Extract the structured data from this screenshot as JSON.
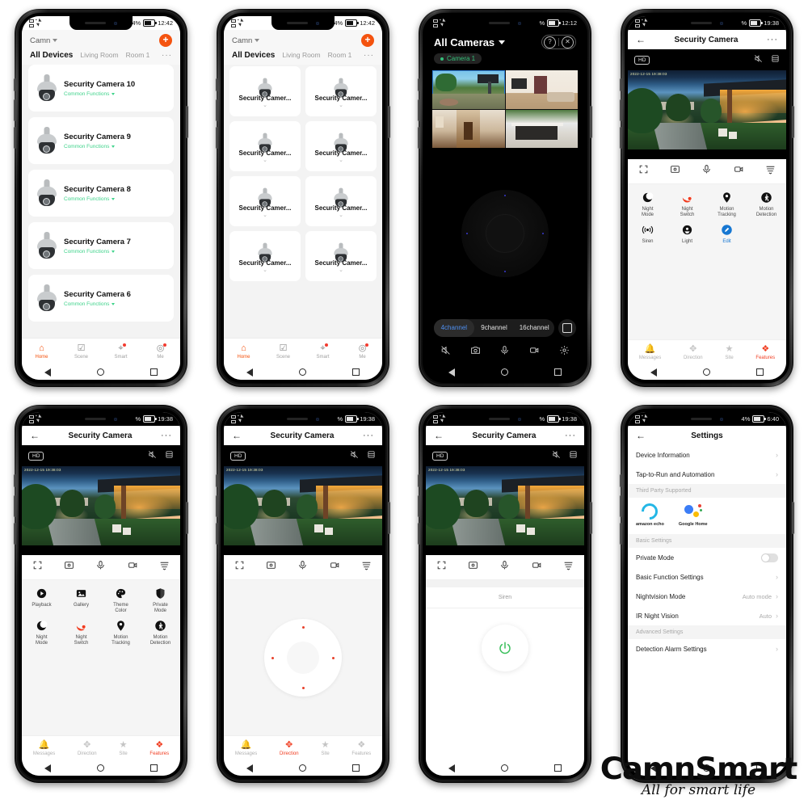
{
  "watermark": {
    "brand": "CamnSmart",
    "tagline": "All for smart life"
  },
  "colors": {
    "accent_orange": "#f4530f",
    "accent_red": "#f03c20",
    "green": "#3fd38b",
    "blue": "#1677d2",
    "select_blue": "#2f7fd6"
  },
  "phone1": {
    "status": {
      "time": "12:42",
      "battery": "4%"
    },
    "family": "Camn",
    "add_label": "+",
    "tabs": [
      {
        "label": "All Devices",
        "active": true
      },
      {
        "label": "Living Room",
        "active": false
      },
      {
        "label": "Room 1",
        "active": false
      }
    ],
    "tabs_more": "···",
    "devices": [
      {
        "name": "Security Camera 10",
        "sub": "Common Functions"
      },
      {
        "name": "Security Camera 9",
        "sub": "Common Functions"
      },
      {
        "name": "Security Camera 8",
        "sub": "Common Functions"
      },
      {
        "name": "Security Camera 7",
        "sub": "Common Functions"
      },
      {
        "name": "Security Camera 6",
        "sub": "Common Functions"
      }
    ],
    "bottom_nav": [
      {
        "label": "Home",
        "active": true
      },
      {
        "label": "Scene",
        "active": false
      },
      {
        "label": "Smart",
        "active": false
      },
      {
        "label": "Me",
        "active": false
      }
    ]
  },
  "phone2": {
    "status": {
      "time": "12:42",
      "battery": "4%"
    },
    "family": "Camn",
    "tabs": [
      {
        "label": "All Devices",
        "active": true
      },
      {
        "label": "Living Room",
        "active": false
      },
      {
        "label": "Room 1",
        "active": false
      }
    ],
    "tabs_more": "···",
    "devices": [
      {
        "name": "Security Camer..."
      },
      {
        "name": "Security Camer..."
      },
      {
        "name": "Security Camer..."
      },
      {
        "name": "Security Camer..."
      },
      {
        "name": "Security Camer..."
      },
      {
        "name": "Security Camer..."
      },
      {
        "name": "Security Camer..."
      },
      {
        "name": "Security Camer..."
      }
    ],
    "bottom_nav": [
      {
        "label": "Home",
        "active": true
      },
      {
        "label": "Scene",
        "active": false
      },
      {
        "label": "Smart",
        "active": false
      },
      {
        "label": "Me",
        "active": false
      }
    ]
  },
  "phone3": {
    "status": {
      "time": "12:12",
      "battery": "%"
    },
    "title": "All Cameras",
    "camera_chip": "Camera 1",
    "help_icon": "?",
    "close_icon": "✕",
    "channels": [
      {
        "label": "4channel",
        "active": true
      },
      {
        "label": "9channel",
        "active": false
      },
      {
        "label": "16channel",
        "active": false
      }
    ],
    "grid_count": 4,
    "toolbar_icons": [
      "mute-icon",
      "snapshot-icon",
      "microphone-icon",
      "record-icon",
      "settings-icon"
    ]
  },
  "phone4": {
    "status": {
      "time": "19:38",
      "battery": "%"
    },
    "title": "Security Camera",
    "quality_badge": "HD",
    "timestamp_overlay": "2022-12-15 19:38:03",
    "controls": [
      "fullscreen-icon",
      "snapshot-icon",
      "microphone-icon",
      "record-icon",
      "playlist-icon"
    ],
    "features": [
      {
        "label": "Night\nMode",
        "icon": "moon-icon",
        "state": "normal"
      },
      {
        "label": "Night\nSwitch",
        "icon": "night-switch-icon",
        "state": "red"
      },
      {
        "label": "Motion\nTracking",
        "icon": "pin-icon",
        "state": "normal"
      },
      {
        "label": "Motion\nDetection",
        "icon": "walking-icon",
        "state": "normal"
      },
      {
        "label": "Siren",
        "icon": "siren-icon",
        "state": "normal"
      },
      {
        "label": "Light",
        "icon": "light-icon",
        "state": "normal"
      },
      {
        "label": "Edit",
        "icon": "edit-icon",
        "state": "blue"
      }
    ],
    "bottom_nav": [
      {
        "label": "Messages",
        "active": false
      },
      {
        "label": "Direction",
        "active": false
      },
      {
        "label": "Site",
        "active": false
      },
      {
        "label": "Features",
        "active": true
      }
    ]
  },
  "phone5": {
    "status": {
      "time": "19:38",
      "battery": "%"
    },
    "title": "Security Camera",
    "quality_badge": "HD",
    "timestamp_overlay": "2022-12-15 19:38:03",
    "features": [
      {
        "label": "Playback",
        "icon": "play-icon",
        "state": "normal"
      },
      {
        "label": "Gallery",
        "icon": "image-icon",
        "state": "normal"
      },
      {
        "label": "Theme\nColor",
        "icon": "palette-icon",
        "state": "normal"
      },
      {
        "label": "Private\nMode",
        "icon": "shield-icon",
        "state": "normal"
      },
      {
        "label": "Night\nMode",
        "icon": "moon-icon",
        "state": "normal"
      },
      {
        "label": "Night\nSwitch",
        "icon": "night-switch-icon",
        "state": "red"
      },
      {
        "label": "Motion\nTracking",
        "icon": "pin-icon",
        "state": "normal"
      },
      {
        "label": "Motion\nDetection",
        "icon": "walking-icon",
        "state": "normal"
      }
    ],
    "bottom_nav": [
      {
        "label": "Messages",
        "active": false
      },
      {
        "label": "Direction",
        "active": false
      },
      {
        "label": "Site",
        "active": false
      },
      {
        "label": "Features",
        "active": true
      }
    ]
  },
  "phone6": {
    "status": {
      "time": "19:38",
      "battery": "%"
    },
    "title": "Security Camera",
    "quality_badge": "HD",
    "timestamp_overlay": "2022-12-15 19:38:03",
    "bottom_nav": [
      {
        "label": "Messages",
        "active": false
      },
      {
        "label": "Direction",
        "active": true
      },
      {
        "label": "Site",
        "active": false
      },
      {
        "label": "Features",
        "active": false
      }
    ]
  },
  "phone7": {
    "status": {
      "time": "19:38",
      "battery": "%"
    },
    "title": "Security Camera",
    "quality_badge": "HD",
    "timestamp_overlay": "2022-12-15 19:38:03",
    "siren_label": "Siren",
    "power_icon": "power-icon"
  },
  "phone8": {
    "status": {
      "time": "6:40",
      "battery": "4%"
    },
    "title": "Settings",
    "rows": [
      {
        "label": "Device Information",
        "value": "",
        "type": "link"
      },
      {
        "label": "Tap-to-Run and Automation",
        "value": "",
        "type": "link"
      },
      {
        "label": "Third Party Supported",
        "type": "header"
      },
      {
        "label": "third-party",
        "type": "thirdparty"
      },
      {
        "label": "Basic Settings",
        "type": "header"
      },
      {
        "label": "Private Mode",
        "value": "",
        "type": "toggle"
      },
      {
        "label": "Basic Function Settings",
        "value": "",
        "type": "link"
      },
      {
        "label": "Nightvision Mode",
        "value": "Auto mode",
        "type": "link"
      },
      {
        "label": "IR Night Vision",
        "value": "Auto",
        "type": "link"
      },
      {
        "label": "Advanced Settings",
        "type": "header"
      },
      {
        "label": "Detection Alarm Settings",
        "value": "",
        "type": "link"
      }
    ],
    "third_party": [
      {
        "name": "amazon echo"
      },
      {
        "name": "Google Home"
      }
    ]
  }
}
